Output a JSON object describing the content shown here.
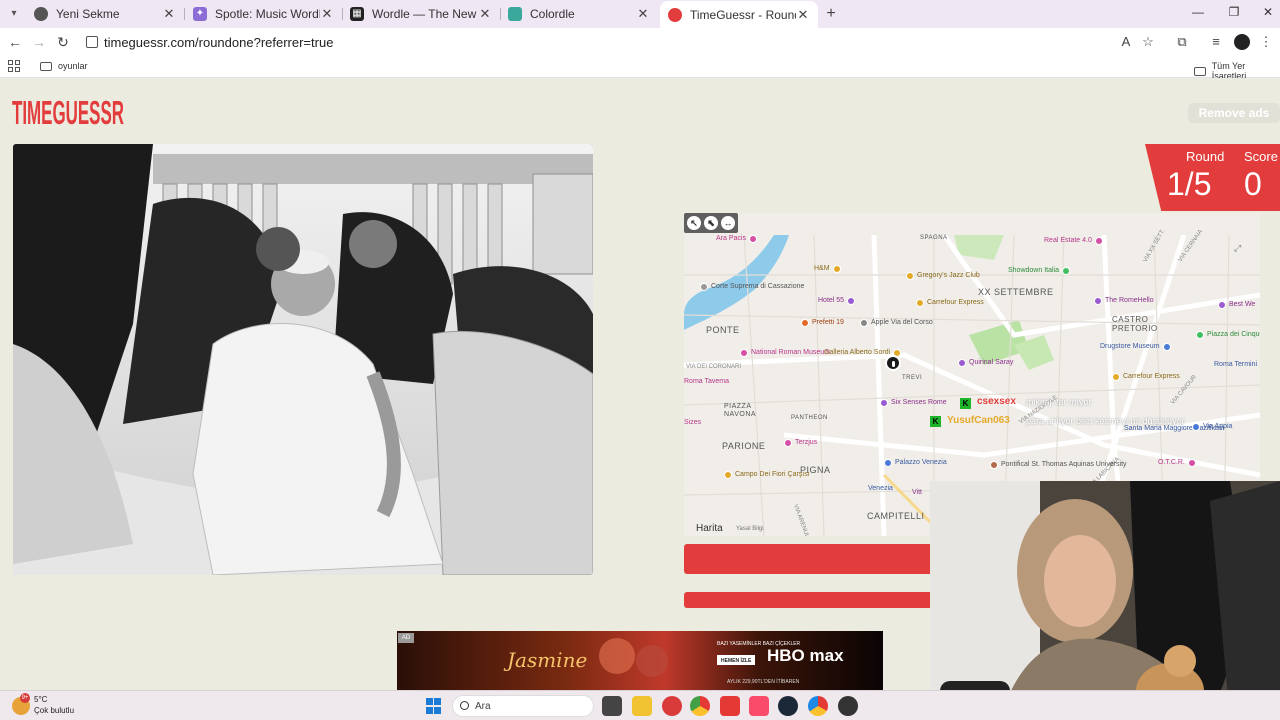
{
  "browser": {
    "tabs": [
      {
        "title": "Yeni Sekme",
        "active": false
      },
      {
        "title": "Spotle: Music Wordle Game",
        "active": false
      },
      {
        "title": "Wordle — The New York Times",
        "active": false
      },
      {
        "title": "Colordle",
        "active": false
      },
      {
        "title": "TimeGuessr - Round One",
        "active": true
      }
    ],
    "url": "timeguessr.com/roundone?referrer=true",
    "bookmarks": {
      "folder_label": "oyunlar",
      "all_bookmarks_label": "Tüm Yer İşaretleri"
    }
  },
  "game": {
    "logo_text": "TIMEGUESSR",
    "remove_ads_label": "Remove ads",
    "round_label": "Round",
    "round_value": "1/5",
    "score_label": "Score",
    "score_value": "0"
  },
  "map": {
    "controls": [
      "↖",
      "⬉",
      "↔"
    ],
    "districts": [
      "XX SETTEMBRE",
      "CASTRO PRETORIO",
      "PONTE",
      "PARIONE",
      "PIGNA",
      "CAMPITELLI",
      "PIAZZA NAVONA",
      "PANTHEON",
      "SPAGNA",
      "TREVI"
    ],
    "pois": [
      "Ara Pacis",
      "H&M",
      "Gregory's Jazz Club",
      "Real Estate 4.0",
      "Showdown Italia",
      "Corte Suprema di Cassazione",
      "Hotel 55",
      "Carrefour Express",
      "The RomeHello",
      "Best We",
      "Prefetti 19",
      "Apple Via del Corso",
      "Piazza dei Cinquecento",
      "Drugstore Museum",
      "National Roman Museum",
      "Galleria Alberto Sordi",
      "Quirinal Saray",
      "Roma Termini",
      "Carrefour Express",
      "Six Senses Rome",
      "Santa Maria Maggiore Bazilikası",
      "Terzjus",
      "Palazzo Venezia",
      "Pontifical St. Thomas Aquinas University",
      "Campo Dei Fiori Çarşısı",
      "Venezia",
      "O.T.C.R.",
      "Via Appia",
      "Roma Tavema",
      "Sizes",
      "Vitt"
    ],
    "streets": [
      "VIA XX SETT.",
      "VIA CERNAIA",
      "VIA NAZIONALE",
      "VIA CAVOUR",
      "VIA DEI CORONARI",
      "VIA LABICANA",
      "VIA ARENULA"
    ],
    "attribution": "Harita",
    "legal": "Yasal Bilgi",
    "expand_icon": "⤢"
  },
  "stream_overlay": {
    "user1": "csexsex",
    "user2": "YusufCan063",
    "msg1": "mikitaj var mıyor",
    "msg2": "para atılıyor bilet kesmeyi mi düşünüyor"
  },
  "ad": {
    "label": "AD",
    "brand": "HBO max",
    "title": "Jasmine",
    "tag": "BAZI YASEMİNLER BAZI ÇİÇEKLER",
    "cta": "HEMEN İZLE",
    "price": "AYLIK 229,90TL'DEN İTİBAREN"
  },
  "taskbar": {
    "weather_temp": "5°C",
    "weather_cond": "Çok bulutlu",
    "weather_badge": "9+",
    "search_placeholder": "Ara",
    "apps": [
      "file-explorer",
      "folder",
      "opera",
      "chrome",
      "lightning",
      "music",
      "steam",
      "chrome-dev",
      "obs"
    ]
  },
  "colors": {
    "accent": "#e23c3c",
    "page_bg": "#ecebe0"
  }
}
